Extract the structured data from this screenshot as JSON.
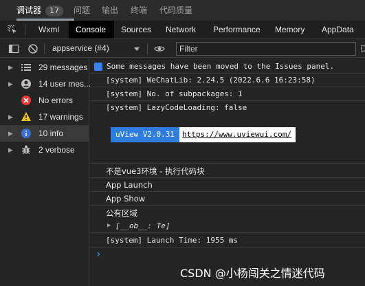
{
  "top_tabs": {
    "debugger_label": "调试器",
    "debugger_count": "17",
    "issues_label": "问题",
    "output_label": "输出",
    "terminal_label": "终端",
    "quality_label": "代码质量"
  },
  "panel_tabs": [
    "Wxml",
    "Console",
    "Sources",
    "Network",
    "Performance",
    "Memory",
    "AppData"
  ],
  "toolbar": {
    "context": "appservice (#4)",
    "filter_placeholder": "Filter",
    "edge_label": "D"
  },
  "sidebar": {
    "items": [
      {
        "label": "29 messages",
        "icon": "list-icon"
      },
      {
        "label": "14 user mes...",
        "icon": "user-icon"
      },
      {
        "label": "No errors",
        "icon": "error-icon"
      },
      {
        "label": "17 warnings",
        "icon": "warning-icon"
      },
      {
        "label": "10 info",
        "icon": "info-icon"
      },
      {
        "label": "2 verbose",
        "icon": "bug-icon"
      }
    ]
  },
  "console": {
    "moved_notice": "Some messages have been moved to the Issues panel.",
    "lines": [
      "[system] WeChatLib: 2.24.5 (2022.6.6 16:23:58)",
      "[system] No. of subpackages: 1",
      "[system] LazyCodeLoading: false"
    ],
    "uview_version": "uView V2.0.31",
    "uview_url": "https://www.uviewui.com/",
    "env_line": "不是vue3环境 - 执行代码块",
    "app_launch": "App Launch",
    "app_show": "App Show",
    "public_area": "公有区域",
    "object_line": "[__ob__: Te]",
    "launch_time": "[system] Launch Time: 1955 ms",
    "prompt": "›"
  },
  "watermark": "CSDN @小杨闯关之情迷代码",
  "colors": {
    "accent_blue": "#2f7de1",
    "error_red": "#e53935",
    "warning_yellow": "#f5c518",
    "info_blue": "#3b6fd8"
  }
}
